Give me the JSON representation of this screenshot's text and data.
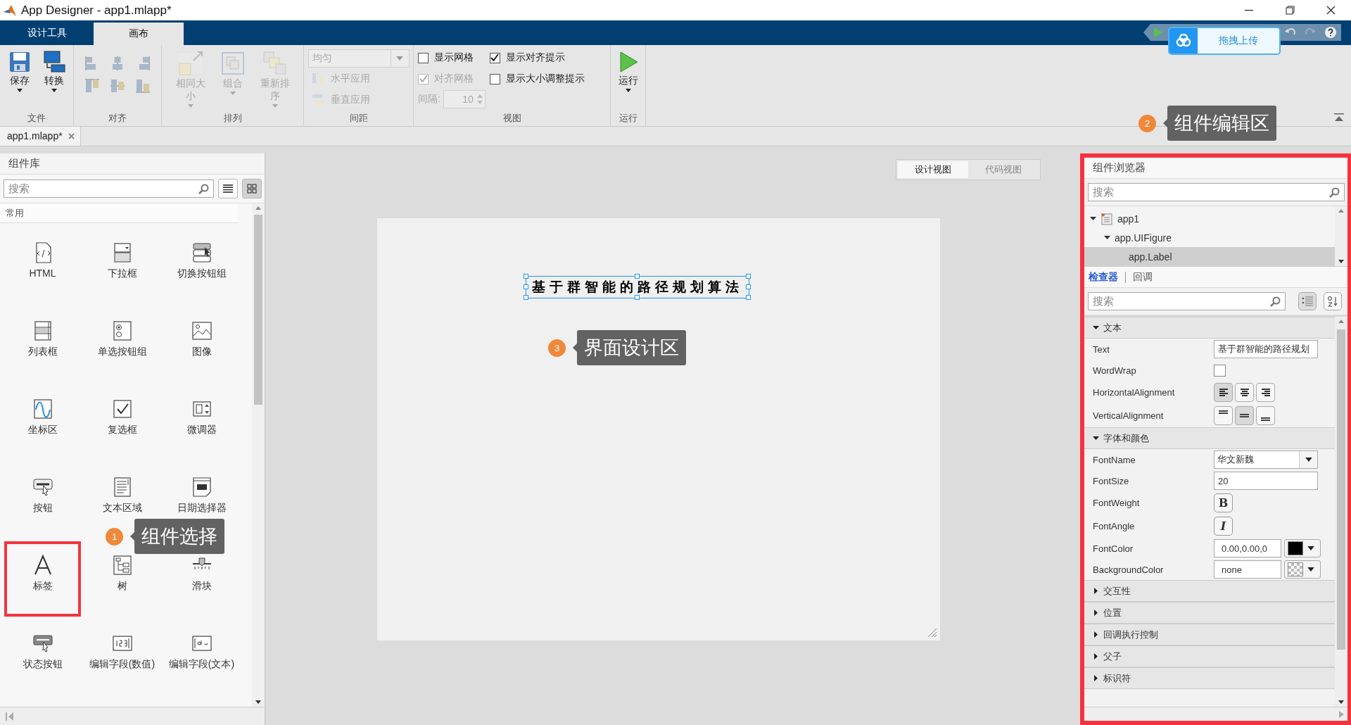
{
  "window": {
    "title": "App Designer - app1.mlapp*"
  },
  "ribbon_tabs": [
    {
      "label": "设计工具",
      "selected": false
    },
    {
      "label": "画布",
      "selected": true
    }
  ],
  "ribbon_groups": [
    {
      "kind": "file",
      "label": "文件",
      "buttons": [
        {
          "label": "保存",
          "disabled": false
        },
        {
          "label": "转换",
          "disabled": false
        }
      ]
    },
    {
      "kind": "align",
      "label": "对齐",
      "buttons": [
        {
          "disabled": true
        },
        {
          "disabled": true
        },
        {
          "disabled": true
        },
        {
          "disabled": true
        },
        {
          "disabled": true
        },
        {
          "disabled": true
        }
      ]
    },
    {
      "kind": "arrange",
      "label": "排列",
      "buttons": [
        {
          "label": "相同大小",
          "disabled": true
        },
        {
          "label": "组合",
          "disabled": true
        },
        {
          "label": "重新排序",
          "disabled": true
        }
      ]
    },
    {
      "kind": "spacing",
      "label": "间距",
      "dropdown": {
        "value": "均匀",
        "disabled": true
      },
      "buttons": [
        {
          "label": "水平应用",
          "disabled": true
        },
        {
          "label": "垂直应用",
          "disabled": true
        }
      ]
    },
    {
      "kind": "view",
      "label": "视图",
      "checkboxes": [
        {
          "label": "显示网格",
          "checked": false,
          "disabled": false
        },
        {
          "label": "对齐网格",
          "checked": true,
          "disabled": true
        },
        {
          "label": "显示对齐提示",
          "checked": true,
          "disabled": false
        },
        {
          "label": "显示大小调整提示",
          "checked": false,
          "disabled": false
        }
      ],
      "spacing": {
        "label": "间隔:",
        "value": "10",
        "disabled": true
      }
    },
    {
      "kind": "run",
      "label": "运行",
      "buttons": [
        {
          "label": "运行",
          "disabled": false
        }
      ]
    }
  ],
  "upload_button": {
    "label": "拖拽上传"
  },
  "document_tabs": [
    {
      "label": "app1.mlapp*",
      "selected": true
    }
  ],
  "component_library": {
    "title": "组件库",
    "search": {
      "placeholder": "搜索"
    },
    "view_buttons": [
      {
        "selected": false
      },
      {
        "selected": true
      }
    ],
    "section": "常用",
    "components": [
      {
        "label": "HTML",
        "highlighted": false
      },
      {
        "label": "下拉框",
        "highlighted": false
      },
      {
        "label": "切换按钮组",
        "highlighted": false
      },
      {
        "label": "列表框",
        "highlighted": false
      },
      {
        "label": "单选按钮组",
        "highlighted": false
      },
      {
        "label": "图像",
        "highlighted": false
      },
      {
        "label": "坐标区",
        "highlighted": false
      },
      {
        "label": "复选框",
        "highlighted": false
      },
      {
        "label": "微调器",
        "highlighted": false
      },
      {
        "label": "按钮",
        "highlighted": false
      },
      {
        "label": "文本区域",
        "highlighted": false
      },
      {
        "label": "日期选择器",
        "highlighted": false
      },
      {
        "label": "标签",
        "highlighted": true
      },
      {
        "label": "树",
        "highlighted": false
      },
      {
        "label": "滑块",
        "highlighted": false
      },
      {
        "label": "状态按钮",
        "highlighted": false
      },
      {
        "label": "编辑字段(数值)",
        "highlighted": false
      },
      {
        "label": "编辑字段(文本)",
        "highlighted": false
      }
    ]
  },
  "view_toggle": [
    {
      "label": "设计视图",
      "selected": true
    },
    {
      "label": "代码视图",
      "selected": false
    }
  ],
  "canvas": {
    "label": {
      "text": "基于群智能的路径规划算法",
      "selected": true
    }
  },
  "component_browser": {
    "title": "组件浏览器",
    "highlighted": true,
    "search": {
      "placeholder": "搜索"
    },
    "tree": [
      {
        "label": "app1",
        "expanded": true,
        "selected": false,
        "children": [
          {
            "label": "app.UIFigure",
            "expanded": true,
            "selected": false,
            "children": [
              {
                "label": "app.Label",
                "selected": true
              }
            ]
          }
        ]
      }
    ],
    "tabs": [
      {
        "label": "检查器",
        "selected": true
      },
      {
        "label": "回调",
        "selected": false
      }
    ],
    "inspector_search": {
      "placeholder": "搜索"
    },
    "sort_buttons": [
      {
        "selected": true
      },
      {
        "selected": false
      }
    ],
    "sections": [
      {
        "title": "文本",
        "expanded": true,
        "properties": [
          {
            "kind": "text",
            "name": "Text",
            "value": "基于群智能的路径规划"
          },
          {
            "kind": "checkbox",
            "name": "WordWrap",
            "checked": false
          },
          {
            "kind": "align",
            "name": "HorizontalAlignment",
            "options": [
              {
                "selected": true
              },
              {
                "selected": false
              },
              {
                "selected": false
              }
            ]
          },
          {
            "kind": "valign",
            "name": "VerticalAlignment",
            "options": [
              {
                "selected": false
              },
              {
                "selected": true
              },
              {
                "selected": false
              }
            ]
          }
        ]
      },
      {
        "title": "字体和颜色",
        "expanded": true,
        "properties": [
          {
            "kind": "dropdown",
            "name": "FontName",
            "value": "华文新魏"
          },
          {
            "kind": "text",
            "name": "FontSize",
            "value": "20"
          },
          {
            "kind": "toggle",
            "name": "FontWeight",
            "value": "B",
            "selected": false
          },
          {
            "kind": "toggle",
            "name": "FontAngle",
            "value": "I",
            "selected": false
          },
          {
            "kind": "color",
            "name": "FontColor",
            "value": "0.00,0.00,0",
            "color": "#000000"
          },
          {
            "kind": "color",
            "name": "BackgroundColor",
            "value": "none"
          }
        ]
      },
      {
        "title": "交互性",
        "expanded": false
      },
      {
        "title": "位置",
        "expanded": false
      },
      {
        "title": "回调执行控制",
        "expanded": false
      },
      {
        "title": "父子",
        "expanded": false
      },
      {
        "title": "标识符",
        "expanded": false
      }
    ]
  },
  "annotations": [
    {
      "number": "1",
      "text": "组件选择"
    },
    {
      "number": "2",
      "text": "组件编辑区"
    },
    {
      "number": "3",
      "text": "界面设计区"
    }
  ]
}
